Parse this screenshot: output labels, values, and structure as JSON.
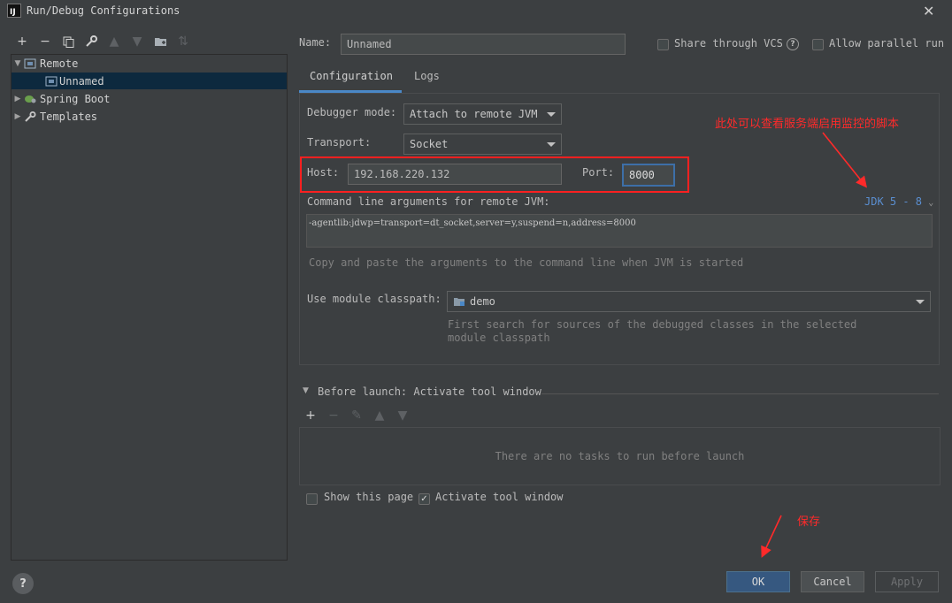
{
  "window": {
    "title": "Run/Debug Configurations",
    "app_icon": "IJ"
  },
  "tree": {
    "items": [
      {
        "label": "Remote",
        "icon": "remote-icon",
        "expanded": true
      },
      {
        "label": "Unnamed",
        "icon": "remote-config-icon",
        "selected": true
      },
      {
        "label": "Spring Boot",
        "icon": "spring-boot-icon",
        "expanded": false
      },
      {
        "label": "Templates",
        "icon": "wrench-icon",
        "expanded": false
      }
    ]
  },
  "header": {
    "name_label": "Name:",
    "name_value": "Unnamed",
    "share_label": "Share through VCS",
    "allow_parallel_label": "Allow parallel run"
  },
  "tabs": [
    {
      "label": "Configuration",
      "active": true
    },
    {
      "label": "Logs",
      "active": false
    }
  ],
  "config": {
    "debugger_mode_label": "Debugger mode:",
    "debugger_mode_value": "Attach to remote JVM",
    "transport_label": "Transport:",
    "transport_value": "Socket",
    "host_label": "Host:",
    "host_value": "192.168.220.132",
    "port_label": "Port:",
    "port_value": "8000",
    "cmd_label": "Command line arguments for remote JVM:",
    "jdk_link": "JDK 5 - 8",
    "cmd_value": "-agentlib:jdwp=transport=dt_socket,server=y,suspend=n,address=8000",
    "cmd_hint": "Copy and paste the arguments to the command line when JVM is started",
    "module_label": "Use module classpath:",
    "module_value": "demo",
    "module_hint_1": "First search for sources of the debugged classes in the selected",
    "module_hint_2": "module classpath"
  },
  "before_launch": {
    "title": "Before launch: Activate tool window",
    "empty_text": "There are no tasks to run before launch",
    "show_page_label": "Show this page",
    "show_page_checked": false,
    "activate_label": "Activate tool window",
    "activate_checked": true
  },
  "buttons": {
    "ok": "OK",
    "cancel": "Cancel",
    "apply": "Apply",
    "help": "?"
  },
  "annotations": {
    "script_note": "此处可以查看服务端启用监控的脚本",
    "save_note": "保存",
    "color": "#ff2a2a"
  },
  "colors": {
    "background": "#3c3f41",
    "accent": "#4a88c7",
    "selected_row": "#0d293e",
    "primary_button": "#365880"
  }
}
